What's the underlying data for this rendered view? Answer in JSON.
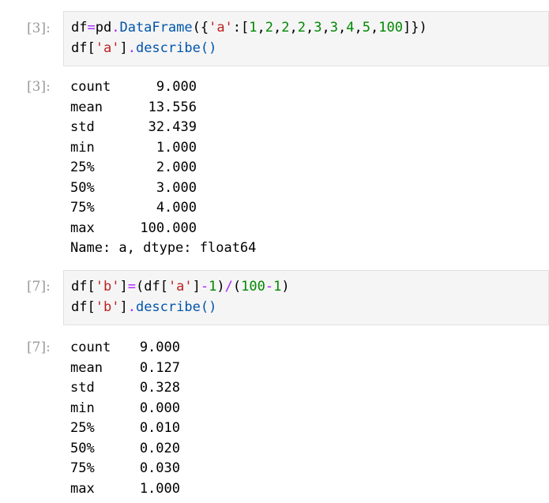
{
  "cells": [
    {
      "in_prompt": "[3]:",
      "out_prompt": "[3]:",
      "code_lines": [
        [
          {
            "t": "df",
            "c": "n"
          },
          {
            "t": "=",
            "c": "o"
          },
          {
            "t": "pd",
            "c": "n"
          },
          {
            "t": ".",
            "c": "o"
          },
          {
            "t": "DataFrame",
            "c": "a"
          },
          {
            "t": "({",
            "c": "p"
          },
          {
            "t": "'a'",
            "c": "s"
          },
          {
            "t": ":[",
            "c": "p"
          },
          {
            "t": "1",
            "c": "num"
          },
          {
            "t": ",",
            "c": "p"
          },
          {
            "t": "2",
            "c": "num"
          },
          {
            "t": ",",
            "c": "p"
          },
          {
            "t": "2",
            "c": "num"
          },
          {
            "t": ",",
            "c": "p"
          },
          {
            "t": "2",
            "c": "num"
          },
          {
            "t": ",",
            "c": "p"
          },
          {
            "t": "3",
            "c": "num"
          },
          {
            "t": ",",
            "c": "p"
          },
          {
            "t": "3",
            "c": "num"
          },
          {
            "t": ",",
            "c": "p"
          },
          {
            "t": "4",
            "c": "num"
          },
          {
            "t": ",",
            "c": "p"
          },
          {
            "t": "5",
            "c": "num"
          },
          {
            "t": ",",
            "c": "p"
          },
          {
            "t": "100",
            "c": "num"
          },
          {
            "t": "]})",
            "c": "p"
          }
        ],
        [
          {
            "t": "df",
            "c": "n"
          },
          {
            "t": "[",
            "c": "p"
          },
          {
            "t": "'a'",
            "c": "s"
          },
          {
            "t": "]",
            "c": "p"
          },
          {
            "t": ".",
            "c": "o"
          },
          {
            "t": "describe",
            "c": "a"
          },
          {
            "t": "()",
            "c": "f"
          }
        ]
      ],
      "output_rows": [
        {
          "label": "count",
          "value": "9.000"
        },
        {
          "label": "mean",
          "value": "13.556"
        },
        {
          "label": "std",
          "value": "32.439"
        },
        {
          "label": "min",
          "value": "1.000"
        },
        {
          "label": "25%",
          "value": "2.000"
        },
        {
          "label": "50%",
          "value": "3.000"
        },
        {
          "label": "75%",
          "value": "4.000"
        },
        {
          "label": "max",
          "value": "100.000"
        }
      ],
      "output_footer": "Name: a, dtype: float64"
    },
    {
      "in_prompt": "[7]:",
      "out_prompt": "[7]:",
      "code_lines": [
        [
          {
            "t": "df",
            "c": "n"
          },
          {
            "t": "[",
            "c": "p"
          },
          {
            "t": "'b'",
            "c": "s"
          },
          {
            "t": "]",
            "c": "p"
          },
          {
            "t": "=",
            "c": "o"
          },
          {
            "t": "(",
            "c": "p"
          },
          {
            "t": "df",
            "c": "n"
          },
          {
            "t": "[",
            "c": "p"
          },
          {
            "t": "'a'",
            "c": "s"
          },
          {
            "t": "]",
            "c": "p"
          },
          {
            "t": "-",
            "c": "o"
          },
          {
            "t": "1",
            "c": "num"
          },
          {
            "t": ")",
            "c": "p"
          },
          {
            "t": "/",
            "c": "o"
          },
          {
            "t": "(",
            "c": "p"
          },
          {
            "t": "100",
            "c": "num"
          },
          {
            "t": "-",
            "c": "o"
          },
          {
            "t": "1",
            "c": "num"
          },
          {
            "t": ")",
            "c": "p"
          }
        ],
        [
          {
            "t": "df",
            "c": "n"
          },
          {
            "t": "[",
            "c": "p"
          },
          {
            "t": "'b'",
            "c": "s"
          },
          {
            "t": "]",
            "c": "p"
          },
          {
            "t": ".",
            "c": "o"
          },
          {
            "t": "describe",
            "c": "a"
          },
          {
            "t": "()",
            "c": "f"
          }
        ]
      ],
      "output_rows": [
        {
          "label": "count",
          "value": "9.000"
        },
        {
          "label": "mean",
          "value": "0.127"
        },
        {
          "label": "std",
          "value": "0.328"
        },
        {
          "label": "min",
          "value": "0.000"
        },
        {
          "label": "25%",
          "value": "0.010"
        },
        {
          "label": "50%",
          "value": "0.020"
        },
        {
          "label": "75%",
          "value": "0.030"
        },
        {
          "label": "max",
          "value": "1.000"
        }
      ],
      "output_footer": ""
    }
  ]
}
